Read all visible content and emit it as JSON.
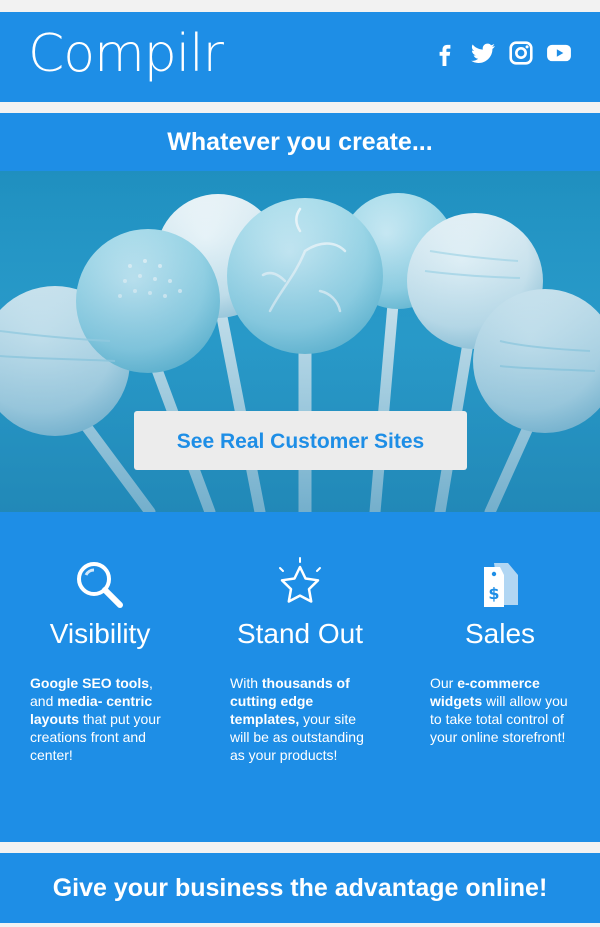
{
  "header": {
    "logo": "Compilr",
    "social": [
      {
        "name": "facebook-icon"
      },
      {
        "name": "twitter-icon"
      },
      {
        "name": "instagram-icon"
      },
      {
        "name": "youtube-icon"
      }
    ]
  },
  "hero": {
    "title": "Whatever you create...",
    "cta_label": "See Real Customer Sites"
  },
  "features": [
    {
      "icon": "magnifier-icon",
      "title": "Visibility",
      "text": [
        {
          "t": "Google SEO tools",
          "b": true
        },
        {
          "t": ",\nand ",
          "b": false
        },
        {
          "t": "media- centric\nlayouts",
          "b": true
        },
        {
          "t": " that put your\ncreations front and\ncenter!",
          "b": false
        }
      ]
    },
    {
      "icon": "star-icon",
      "title": "Stand Out",
      "text": [
        {
          "t": "With ",
          "b": false
        },
        {
          "t": "thousands of\ncutting edge\ntemplates,",
          "b": true
        },
        {
          "t": " your site\nwill be as outstanding\nas your products!",
          "b": false
        }
      ]
    },
    {
      "icon": "price-tag-icon",
      "title": "Sales",
      "text": [
        {
          "t": "Our ",
          "b": false
        },
        {
          "t": "e-commerce\nwidgets",
          "b": true
        },
        {
          "t": " will allow you\nto take total control of\nyour online storefront!",
          "b": false
        }
      ]
    }
  ],
  "footer": {
    "title": "Give your business the advantage online!"
  },
  "colors": {
    "brand": "#1e8ee6",
    "background": "#f2f2f2",
    "button_bg": "#ececec"
  }
}
